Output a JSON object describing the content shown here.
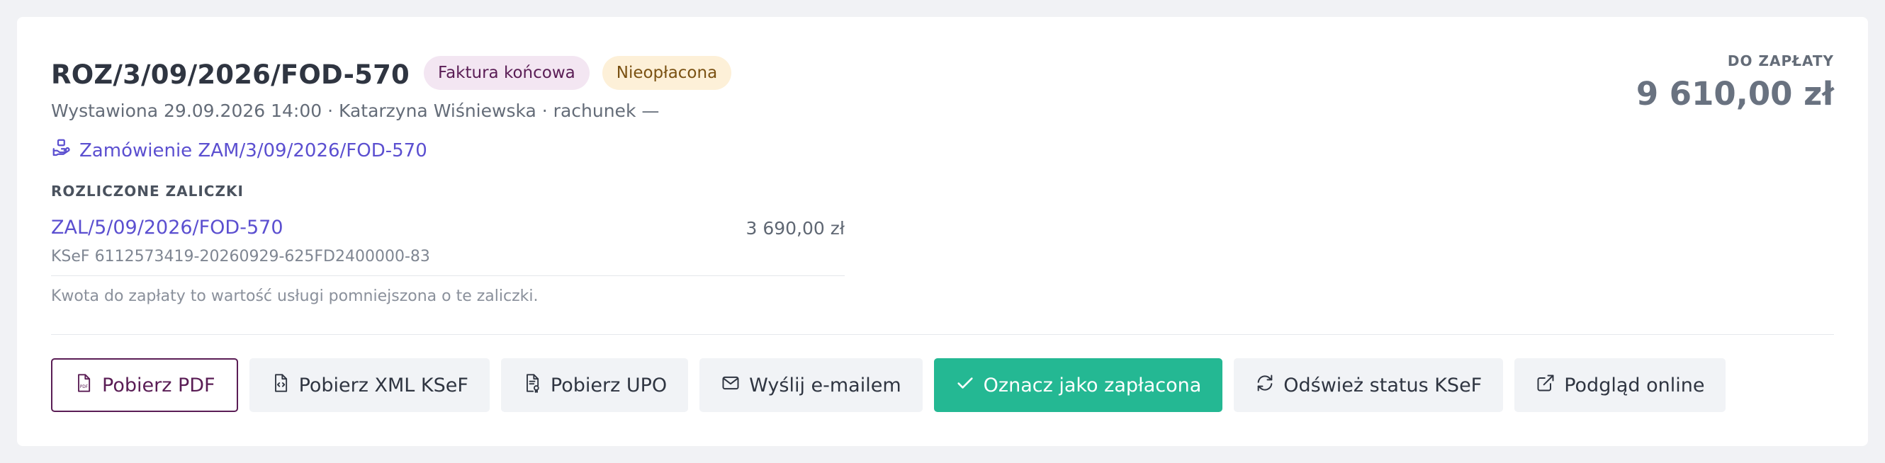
{
  "invoice": {
    "number": "ROZ/3/09/2026/FOD-570",
    "type_badge": "Faktura końcowa",
    "status_badge": "Nieopłacona",
    "meta": "Wystawiona 29.09.2026 14:00 · Katarzyna Wiśniewska · rachunek —",
    "order_link": "Zamówienie ZAM/3/09/2026/FOD-570"
  },
  "advances": {
    "section_label": "ROZLICZONE ZALICZKI",
    "items": [
      {
        "number": "ZAL/5/09/2026/FOD-570",
        "ksef": "KSeF 6112573419-20260929-625FD2400000-83",
        "amount": "3 690,00 zł"
      }
    ],
    "note": "Kwota do zapłaty to wartość usługi pomniejszona o te zaliczki."
  },
  "due": {
    "label": "DO ZAPŁATY",
    "amount": "9 610,00 zł"
  },
  "actions": {
    "download_pdf": "Pobierz PDF",
    "download_xml": "Pobierz XML KSeF",
    "download_upo": "Pobierz UPO",
    "send_email": "Wyślij e-mailem",
    "mark_paid": "Oznacz jako zapłacona",
    "refresh_ksef": "Odśwież status KSeF",
    "preview_online": "Podgląd online"
  },
  "icons": {
    "order": "hand-box-icon",
    "pdf": "pdf-file-icon",
    "xml": "code-file-icon",
    "upo": "receipt-file-icon",
    "email": "envelope-icon",
    "paid": "check-icon",
    "refresh": "refresh-icon",
    "external": "external-link-icon"
  },
  "colors": {
    "brand": "#5a1d55",
    "link": "#5b4fd0",
    "success": "#24b893",
    "badge_type_bg": "#f3e6f2",
    "badge_status_bg": "#fdf0d8"
  }
}
